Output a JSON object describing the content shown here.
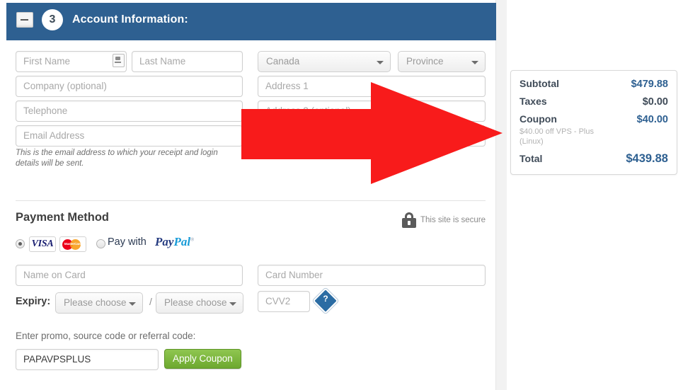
{
  "header": {
    "step_number": "3",
    "title": "Account Information:",
    "collapse_icon": "minus-icon",
    "bg_color": "#2e6091"
  },
  "account_form": {
    "first_name_placeholder": "First Name",
    "last_name_placeholder": "Last Name",
    "company_placeholder": "Company (optional)",
    "telephone_placeholder": "Telephone",
    "email_placeholder": "Email Address",
    "email_note": "This is the email address to which your receipt and login details will be sent.",
    "country_value": "Canada",
    "province_value": "Province",
    "address1_placeholder": "Address 1",
    "address2_placeholder": "Address 2 (optional)"
  },
  "payment": {
    "section_title": "Payment Method",
    "secure_text": "This site is secure",
    "lock_icon": "lock-icon",
    "card_option_selected": true,
    "visa_label": "VISA",
    "mastercard_label": "MasterCard",
    "paypal_prefix": "Pay with",
    "paypal_pay": "Pay",
    "paypal_pal": "Pal",
    "name_on_card_placeholder": "Name on Card",
    "card_number_placeholder": "Card Number",
    "expiry_label": "Expiry:",
    "expiry_month_value": "Please choose",
    "expiry_year_value": "Please choose",
    "expiry_separator": "/",
    "cvv_placeholder": "CVV2",
    "cvv_help_icon": "question-mark-icon",
    "cvv_help_glyph": "?"
  },
  "promo": {
    "label": "Enter promo, source code or referral code:",
    "code_value": "PAPAVPSPLUS",
    "apply_label": "Apply Coupon",
    "apply_color": "#7cb342"
  },
  "summary": {
    "rows": [
      {
        "label": "Subtotal",
        "value": "$479.88",
        "accent": true
      },
      {
        "label": "Taxes",
        "value": "$0.00",
        "accent": false
      },
      {
        "label": "Coupon",
        "value": "$40.00",
        "accent": true,
        "sub": "$40.00 off VPS - Plus (Linux)"
      },
      {
        "label": "Total",
        "value": "$439.88",
        "accent": true,
        "big": true
      }
    ],
    "accent_color": "#2e6091"
  },
  "annotation": {
    "arrow_icon": "red-arrow-right",
    "arrow_color": "#f81b1b"
  }
}
